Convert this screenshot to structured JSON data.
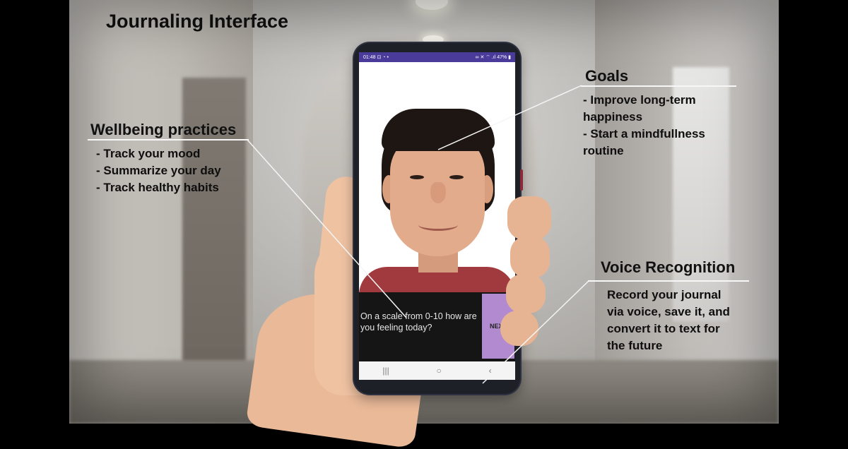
{
  "title": "Journaling Interface",
  "callouts": {
    "wellbeing": {
      "heading": "Wellbeing practices",
      "items": [
        "- Track your mood",
        "- Summarize your day",
        "- Track healthy habits"
      ]
    },
    "goals": {
      "heading": "Goals",
      "items": [
        "- Improve long-term",
        "happiness",
        "- Start a mindfullness",
        "routine"
      ]
    },
    "voice": {
      "heading": "Voice Recognition",
      "lines": [
        "Record your journal",
        "via voice, save it, and",
        "convert it to text for",
        "the future"
      ]
    }
  },
  "phone": {
    "status_time": "01:48",
    "status_icons": "⊡ ◔ •",
    "status_right": "∞ ✕ ⌔ .ıl 47% ▮",
    "question": "On a scale from 0-10 how are you feeling today?",
    "next_label": "NEXT",
    "nav": {
      "recent": "|||",
      "home": "○",
      "back": "‹"
    }
  },
  "colors": {
    "status_bar": "#4a3a9a",
    "next_button": "#b28ad0",
    "prompt_background": "#151515"
  }
}
